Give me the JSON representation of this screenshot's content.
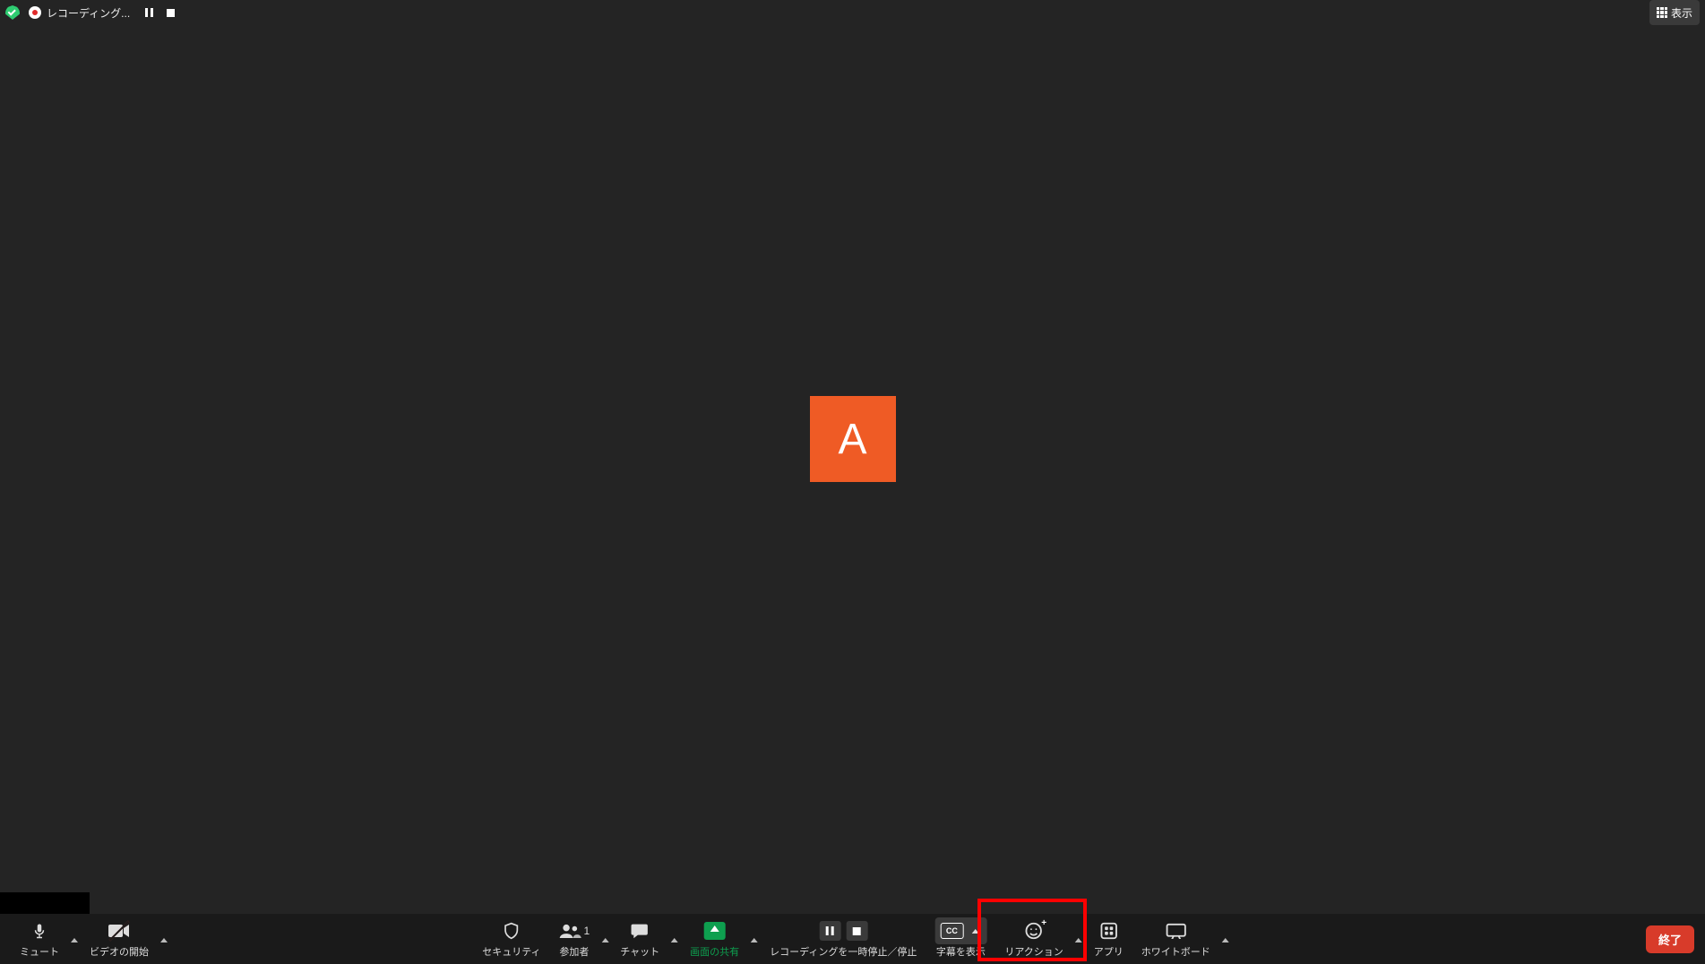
{
  "top": {
    "recording_label": "レコーディング...",
    "view_label": "表示"
  },
  "avatar": {
    "initial": "A"
  },
  "toolbar": {
    "mute": "ミュート",
    "video": "ビデオの開始",
    "security": "セキュリティ",
    "participants": "参加者",
    "participants_count": "1",
    "chat": "チャット",
    "share": "画面の共有",
    "record": "レコーディングを一時停止／停止",
    "captions": "字幕を表示",
    "cc_abbrev": "CC",
    "reactions": "リアクション",
    "apps": "アプリ",
    "whiteboard": "ホワイトボード",
    "end": "終了"
  }
}
